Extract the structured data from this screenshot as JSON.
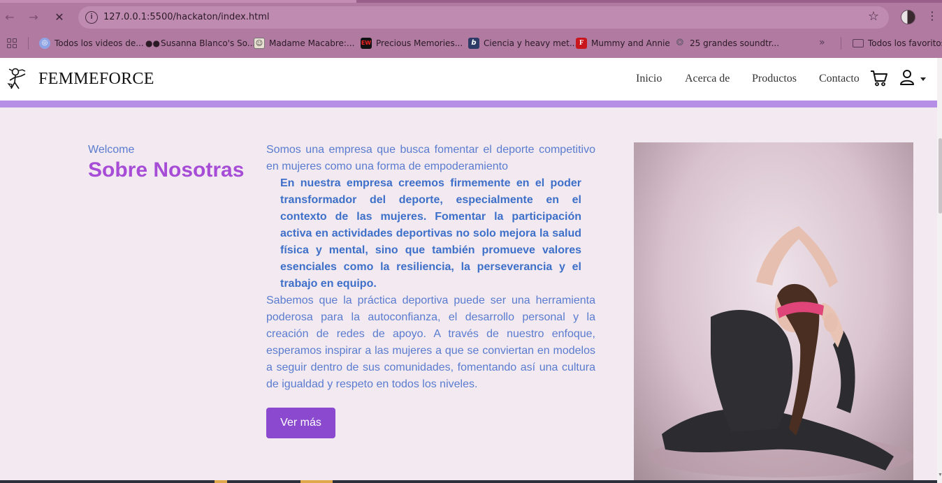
{
  "browser": {
    "url": "127.0.0.1:5500/hackaton/index.html",
    "bookmarks": [
      {
        "label": "Todos los videos de...",
        "icon": "channel-icon"
      },
      {
        "label": "Susanna Blanco's So...",
        "icon": "people-icon"
      },
      {
        "label": "Madame Macabre:...",
        "icon": "portrait-icon"
      },
      {
        "label": "Precious Memories...",
        "icon": "ew-icon"
      },
      {
        "label": "Ciencia y heavy met...",
        "icon": "b-icon"
      },
      {
        "label": "Mummy and Annie",
        "icon": "f-icon"
      },
      {
        "label": "25 grandes soundtr...",
        "icon": "swirl-icon"
      }
    ],
    "all_bookmarks_label": "Todos los favoritos"
  },
  "header": {
    "brand": "FEMMEFORCE",
    "nav": [
      "Inicio",
      "Acerca de",
      "Productos",
      "Contacto"
    ]
  },
  "about": {
    "welcome": "Welcome",
    "title": "Sobre Nosotras",
    "intro": "Somos una empresa que busca fomentar el deporte competitivo en mujeres como una forma de empoderamiento",
    "quote": "En nuestra empresa creemos firmemente en el poder transformador del deporte, especialmente en el contexto de las mujeres. Fomentar la participación activa en actividades deportivas no solo mejora la salud física y mental, sino que también promueve valores esenciales como la resiliencia, la perseverancia y el trabajo en equipo.",
    "paragraph": "Sabemos que la práctica deportiva puede ser una herramienta poderosa para la autoconfianza, el desarrollo personal y la creación de redes de apoyo. A través de nuestro enfoque, esperamos inspirar a las mujeres a que se conviertan en modelos a seguir dentro de sus comunidades, fomentando así una cultura de igualdad y respeto en todos los niveles.",
    "button": "Ver más"
  },
  "colors": {
    "accent_bar": "#b78ee6",
    "title": "#a64cd6",
    "text": "#5a7bd0",
    "button": "#8b49cf"
  }
}
